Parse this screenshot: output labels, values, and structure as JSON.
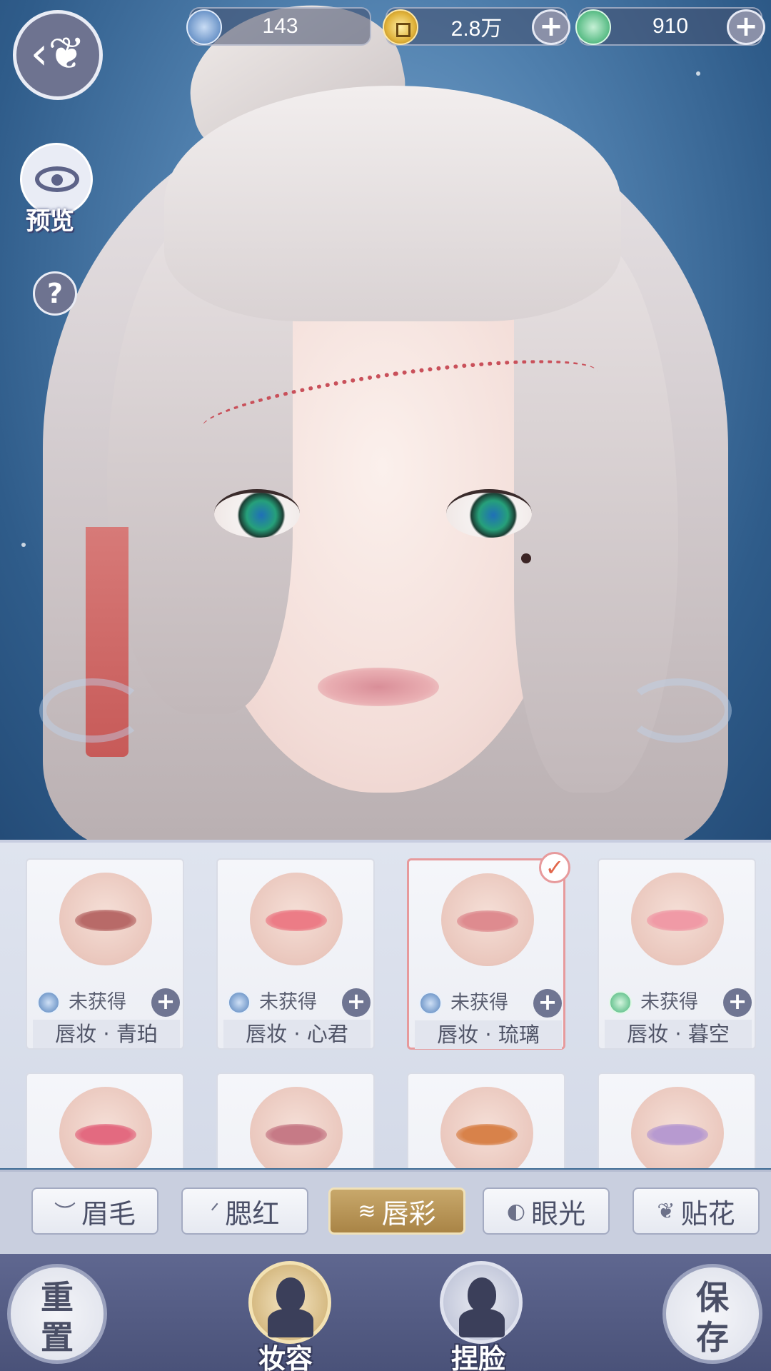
{
  "currencies": [
    {
      "icon": "silver-feather-coin-icon",
      "value": "143",
      "has_plus": false
    },
    {
      "icon": "gold-coin-icon",
      "value": "2.8万",
      "has_plus": true
    },
    {
      "icon": "jade-dragon-coin-icon",
      "value": "910",
      "has_plus": true
    }
  ],
  "side": {
    "back_icon": "butterfly-back-icon",
    "preview_label": "预览",
    "help_label": "?"
  },
  "cards": [
    {
      "status": "未获得",
      "name": "唇妆 · 青珀",
      "currency": "blue",
      "lip_color": "#b86a68",
      "selected": false
    },
    {
      "status": "未获得",
      "name": "唇妆 · 心君",
      "currency": "blue",
      "lip_color": "#ec7c86",
      "selected": false
    },
    {
      "status": "未获得",
      "name": "唇妆 · 琉璃",
      "currency": "blue",
      "lip_color": "#de8b8f",
      "selected": true
    },
    {
      "status": "未获得",
      "name": "唇妆 · 暮空",
      "currency": "green",
      "lip_color": "#f09aa6",
      "selected": false
    },
    {
      "status": "",
      "name": "",
      "currency": "",
      "lip_color": "#e36a80",
      "selected": false
    },
    {
      "status": "",
      "name": "",
      "currency": "",
      "lip_color": "#c67a86",
      "selected": false
    },
    {
      "status": "",
      "name": "",
      "currency": "",
      "lip_color": "#d8824a",
      "selected": false
    },
    {
      "status": "",
      "name": "",
      "currency": "",
      "lip_color": "#b79ad0",
      "selected": false
    }
  ],
  "tabs": [
    {
      "label": "眉毛",
      "icon": "eyebrow-icon",
      "glyph": "︶",
      "active": false
    },
    {
      "label": "腮红",
      "icon": "blush-icon",
      "glyph": "ᐟ",
      "active": false
    },
    {
      "label": "唇彩",
      "icon": "lips-icon",
      "glyph": "≋",
      "active": true
    },
    {
      "label": "眼光",
      "icon": "eye-glint-icon",
      "glyph": "◐",
      "active": false
    },
    {
      "label": "贴花",
      "icon": "leaf-decal-icon",
      "glyph": "❦",
      "active": false
    }
  ],
  "bottom": {
    "reset_line1": "重",
    "reset_line2": "置",
    "makeup_label": "妆容",
    "face_label": "捏脸",
    "save_line1": "保",
    "save_line2": "存"
  },
  "colors": {
    "accent_gold": "#c8a86b",
    "selected_border": "#e79a9c",
    "nav_bg": "#5f6790"
  }
}
